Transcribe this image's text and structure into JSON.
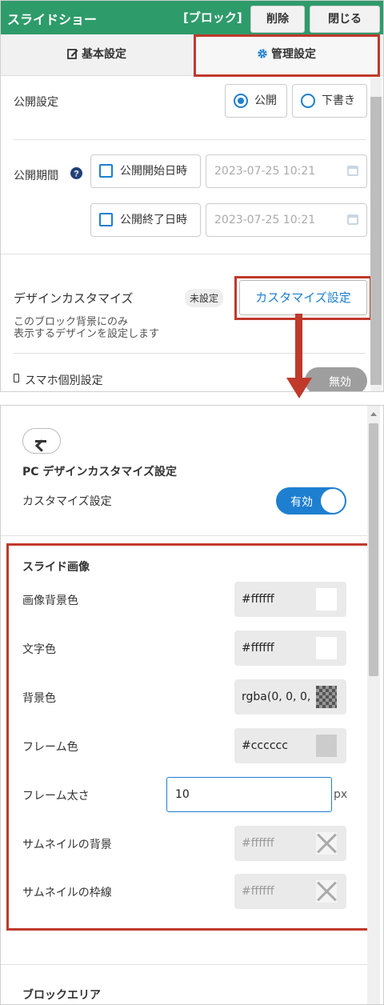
{
  "top_panel": {
    "header": {
      "title": "スライドショー",
      "block_label": "[ブロック]",
      "delete_label": "削除",
      "close_label": "閉じる"
    },
    "tabs": [
      {
        "label": "基本設定",
        "icon": "edit-icon"
      },
      {
        "label": "管理設定",
        "icon": "gear-icon",
        "active": true
      }
    ],
    "publish": {
      "label": "公開設定",
      "options": [
        {
          "label": "公開",
          "selected": true
        },
        {
          "label": "下書き",
          "selected": false
        }
      ]
    },
    "period": {
      "label": "公開期間",
      "start_label": "公開開始日時",
      "start_value": "2023-07-25 10:21",
      "end_label": "公開終了日時",
      "end_value": "2023-07-25 10:21"
    },
    "design": {
      "label": "デザインカスタマイズ",
      "description_line1": "このブロック背景にのみ",
      "description_line2": "表示するデザインを設定します",
      "status": "未設定",
      "button_label": "カスタマイズ設定"
    },
    "mobile": {
      "label": "スマホ個別設定",
      "toggle_label": "無効"
    }
  },
  "bottom_panel": {
    "title": "PC デザインカスタマイズ設定",
    "customize_label": "カスタマイズ設定",
    "customize_toggle": "有効",
    "slide_section": "スライド画像",
    "rows": [
      {
        "label": "画像背景色",
        "value": "#ffffff",
        "swatch": "#ffffff"
      },
      {
        "label": "文字色",
        "value": "#ffffff",
        "swatch": "#ffffff"
      },
      {
        "label": "背景色",
        "value": "rgba(0, 0, 0,",
        "swatch": "transparent-dark"
      },
      {
        "label": "フレーム色",
        "value": "#cccccc",
        "swatch": "#cccccc"
      },
      {
        "label": "フレーム太さ",
        "value": "10",
        "unit": "px"
      },
      {
        "label": "サムネイルの背景",
        "value": "#ffffff",
        "swatch": "none"
      },
      {
        "label": "サムネイルの枠線",
        "value": "#ffffff",
        "swatch": "none"
      }
    ],
    "block_area_section": "ブロックエリア"
  },
  "colors": {
    "header_green": "#2e9b6a",
    "accent_blue": "#1e7fd0",
    "highlight_red": "#c0392b"
  }
}
